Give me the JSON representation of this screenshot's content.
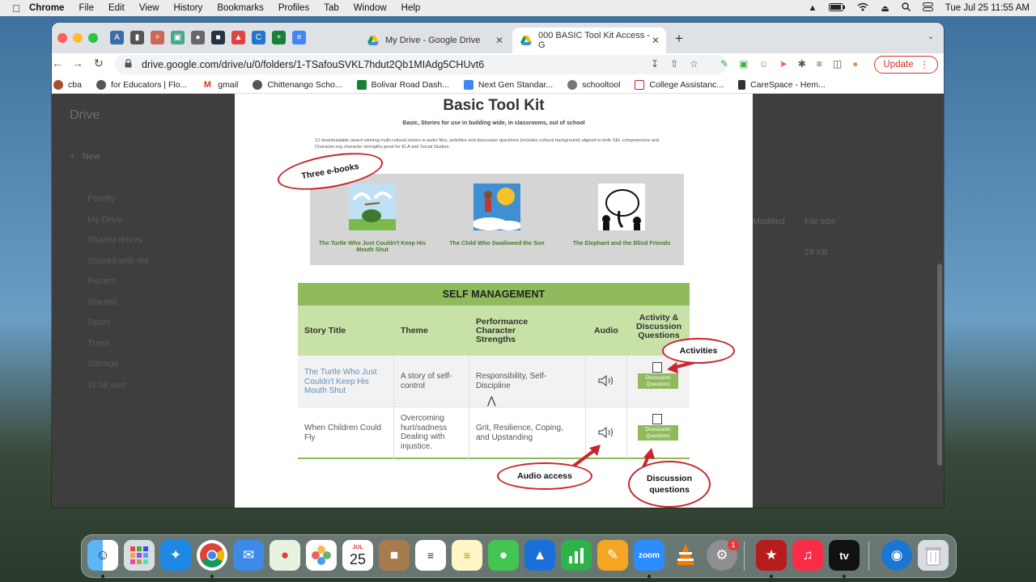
{
  "menubar": {
    "app": "Chrome",
    "items": [
      "File",
      "Edit",
      "View",
      "History",
      "Bookmarks",
      "Profiles",
      "Tab",
      "Window",
      "Help"
    ],
    "datetime": "Tue Jul 25  11:55 AM"
  },
  "tabs": [
    {
      "title": "My Drive - Google Drive"
    },
    {
      "title": "000 BASIC Tool Kit Access - G"
    }
  ],
  "url": "drive.google.com/drive/u/0/folders/1-TSafouSVKL7hdut2Qb1MIAdg5CHUvt6",
  "update_label": "Update",
  "bookmarks": [
    {
      "label": "cba",
      "color": "#a0522d"
    },
    {
      "label": "for Educators | Flo...",
      "color": "#555555"
    },
    {
      "label": "gmail",
      "color": "#d93025"
    },
    {
      "label": "Chittenango Scho...",
      "color": "#555555"
    },
    {
      "label": "Bolivar Road Dash...",
      "color": "#188038"
    },
    {
      "label": "Next Gen Standar...",
      "color": "#4285f4"
    },
    {
      "label": "schooltool",
      "color": "#555555"
    },
    {
      "label": "College Assistanc...",
      "color": "#c5221f"
    },
    {
      "label": "CareSpace - Hem...",
      "color": "#333333"
    }
  ],
  "drive": {
    "logo": "Drive",
    "new_label": "New",
    "sidebar": [
      "Priority",
      "My Drive",
      "Shared drives",
      "Shared with me",
      "Recent",
      "Starred",
      "Spam",
      "Trash",
      "Storage",
      "19 GB used"
    ],
    "col_modified": "Modified",
    "col_size": "File size",
    "file_size": "29 KB"
  },
  "doc": {
    "title": "Basic Tool Kit",
    "subtitle": "Basic, Stories for use in building wide, in classrooms, out of school",
    "description": "12 downloadable award winning multi-cultural stories w audio files, activities and discussion questions (includes cultural background) aligned to both SEL competencies and Character.org character strengths great for ELA and Social Studies.",
    "books": [
      {
        "title": "The Turtle Who Just Couldn't Keep His Mouth Shut"
      },
      {
        "title": "The Child Who Swallowed the Sun"
      },
      {
        "title": "The Elephant and the Blind Friends"
      }
    ],
    "table": {
      "heading": "SELF MANAGEMENT",
      "columns": [
        "Story Title",
        "Theme",
        "Performance Character Strengths",
        "Audio",
        "Activity & Discussion Questions"
      ],
      "rows": [
        {
          "title": "The Turtle Who Just Couldn't Keep His Mouth Shut",
          "theme": "A story of self-control",
          "strengths": "Responsibility, Self-Discipline"
        },
        {
          "title": "When Children Could Fly",
          "theme": "Overcoming hurt/sadness Dealing with injustice.",
          "strengths": "Grit, Resilience, Coping, and Upstanding"
        }
      ],
      "dq_label": "Discussion Questions"
    },
    "annotations": {
      "ebooks": "Three e-books",
      "activities": "Activities",
      "audio": "Audio access",
      "discussion": "Discussion questions"
    }
  },
  "dock": {
    "calendar_month": "JUL",
    "calendar_day": "25",
    "zoom_label": "zoom",
    "tv_label": "tv",
    "settings_badge": "1"
  }
}
